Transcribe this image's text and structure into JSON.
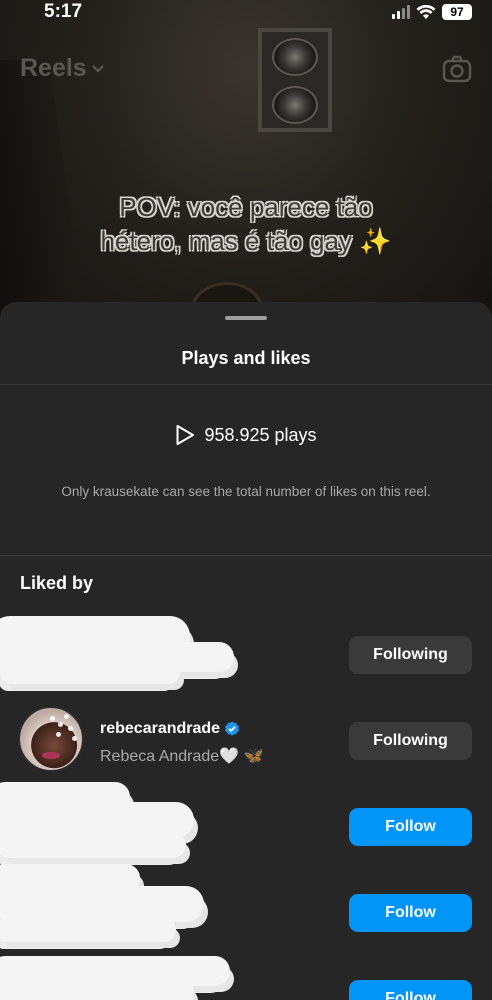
{
  "status_bar": {
    "time": "5:17",
    "battery": "97"
  },
  "header": {
    "title": "Reels"
  },
  "reel": {
    "caption_line1": "POV: você parece tão",
    "caption_line2": "hétero, mas é tão gay",
    "caption_emoji": "✨"
  },
  "sheet": {
    "title": "Plays and likes",
    "plays": "958.925 plays",
    "likes_note": "Only krausekate can see the total number of likes on this reel.",
    "liked_by_heading": "Liked by",
    "users": [
      {
        "button": "Following"
      },
      {
        "username": "rebecarandrade",
        "full_name": "Rebeca Andrade",
        "name_emoji_1": "🤍",
        "name_emoji_2": "🦋",
        "button": "Following"
      },
      {
        "button": "Follow"
      },
      {
        "button": "Follow"
      },
      {
        "button": "Follow"
      }
    ]
  },
  "colors": {
    "sheet_bg": "#262626",
    "follow_blue": "#0095f6",
    "following_gray": "#3a3a3a",
    "verified_blue": "#1c96f0"
  }
}
